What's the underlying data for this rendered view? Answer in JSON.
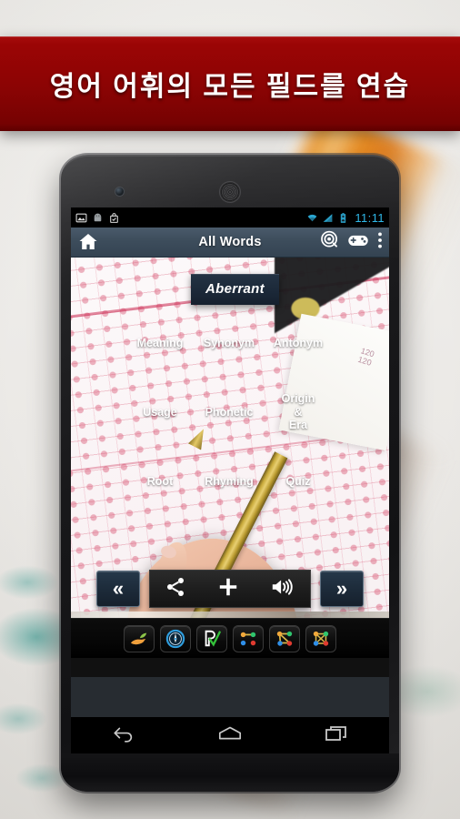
{
  "banner": {
    "text": "영어 어휘의 모든 필드를 연습"
  },
  "colors": {
    "banner_red": "#8c0404",
    "actionbar_blue": "#3e4e5d",
    "button_slate": "#46525f",
    "card_navy": "#1b2838",
    "status_time_cyan": "#2fb8e8"
  },
  "phone": {
    "statusbar": {
      "left_icons": [
        "image-icon",
        "android-icon",
        "shopping-bag-icon"
      ],
      "right_icons": [
        "wifi-icon",
        "signal-icon",
        "battery-icon"
      ],
      "time": "11:11"
    },
    "actionbar": {
      "home_icon": "home-icon",
      "title": "All Words",
      "right_icons": [
        "target-icon",
        "gamepad-icon",
        "overflow-menu-icon"
      ]
    },
    "app": {
      "word_card": {
        "word": "Aberrant"
      },
      "grid_buttons": [
        {
          "label": "Meaning"
        },
        {
          "label": "Synonym"
        },
        {
          "label": "Antonym"
        },
        {
          "label": "Usage"
        },
        {
          "label": "Phonetic"
        },
        {
          "label": "Origin\n&\nEra"
        },
        {
          "label": "Root"
        },
        {
          "label": "Rhyming"
        },
        {
          "label": "Quiz"
        }
      ],
      "toolbar": {
        "prev_label": "«",
        "next_label": "»",
        "center_icons": [
          "share-icon",
          "plus-icon",
          "speaker-icon"
        ]
      },
      "icon_strip": [
        {
          "name": "hand-leaf-icon"
        },
        {
          "name": "compass-icon"
        },
        {
          "name": "p-check-icon"
        },
        {
          "name": "graph-dots-icon"
        },
        {
          "name": "graph-star-icon"
        },
        {
          "name": "graph-mesh-icon"
        }
      ]
    },
    "navbar": {
      "buttons": [
        "back-icon",
        "home-icon",
        "recents-icon"
      ]
    }
  }
}
